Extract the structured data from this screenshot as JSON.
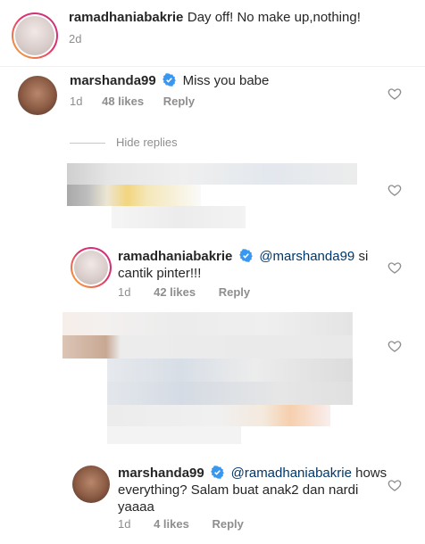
{
  "caption": {
    "username": "ramadhaniabakrie",
    "text": "Day off! No make up,nothing!",
    "time": "2d"
  },
  "comments": [
    {
      "username": "marshanda99",
      "text": "Miss you babe",
      "time": "1d",
      "likes": "48 likes",
      "reply": "Reply"
    }
  ],
  "hide_replies": "Hide replies",
  "replies": [
    {
      "username": "ramadhaniabakrie",
      "mention": "@marshanda99",
      "text_line1": " si",
      "text_line2": "cantik pinter!!!",
      "time": "1d",
      "likes": "42 likes",
      "reply": "Reply"
    },
    {
      "username": "marshanda99",
      "mention": "@ramadhaniabakrie",
      "text_line1": " hows",
      "text_line2": "everything? Salam buat anak2 dan nardi",
      "text_line3": "yaaaa",
      "time": "1d",
      "likes": "4 likes",
      "reply": "Reply"
    }
  ],
  "colors": {
    "verified": "#3897f0",
    "mention": "#00376b",
    "meta": "#8e8e8e"
  }
}
